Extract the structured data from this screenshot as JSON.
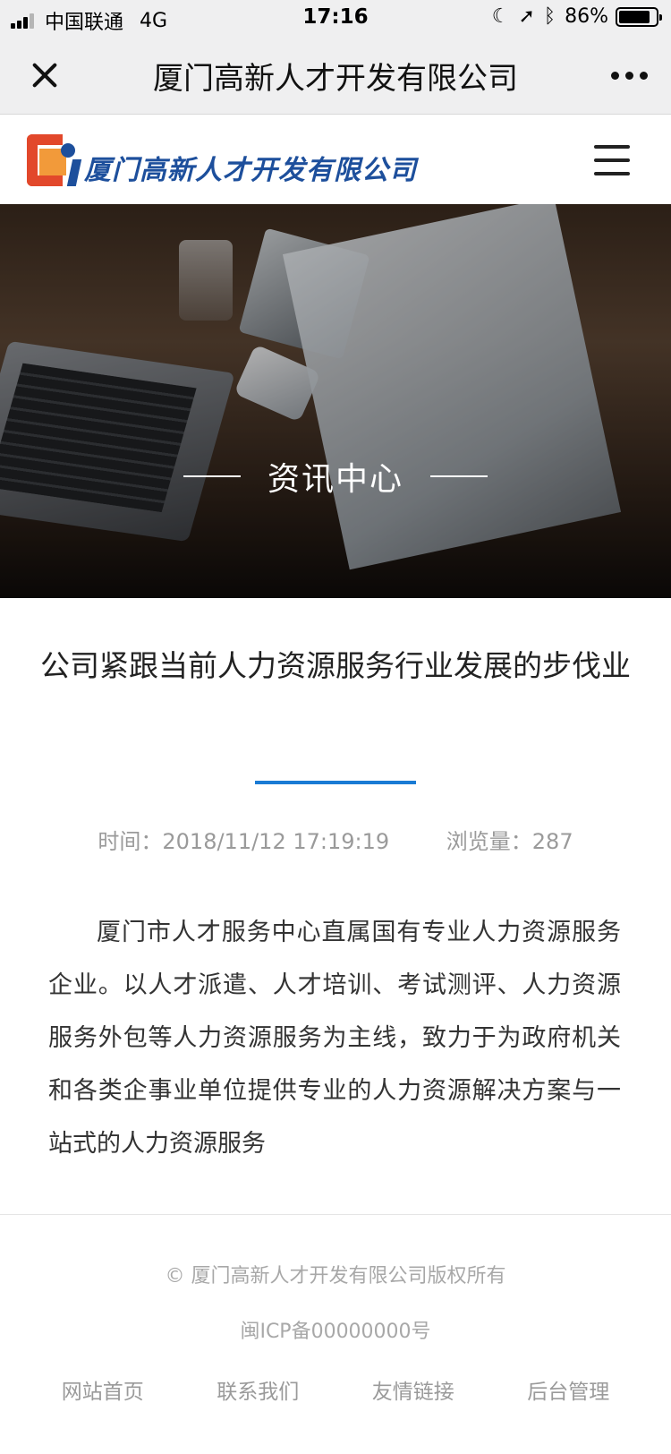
{
  "status_bar": {
    "carrier": "中国联通",
    "network": "4G",
    "time": "17:16",
    "battery": "86%",
    "battery_level": 0.86
  },
  "nav_bar": {
    "title": "厦门高新人才开发有限公司"
  },
  "site_header": {
    "logo_text": "厦门高新人才开发有限公司",
    "colors": {
      "logo_blue": "#1d4f9c",
      "logo_red": "#e2482b",
      "logo_orange": "#f29a3a"
    }
  },
  "banner": {
    "title": "资讯中心"
  },
  "article": {
    "title": "公司紧跟当前人力资源服务行业发展的步伐业",
    "time_label": "时间：",
    "time_value": "2018/11/12 17:19:19",
    "views_label": "浏览量：",
    "views_value": "287",
    "body": "厦门市人才服务中心直属国有专业人力资源服务企业。以人才派遣、人才培训、考试测评、人力资源服务外包等人力资源服务为主线，致力于为政府机关和各类企事业单位提供专业的人力资源解决方案与一站式的人力资源服务",
    "accent_color": "#1a7bd4"
  },
  "footer": {
    "copyright": "© 厦门高新人才开发有限公司版权所有",
    "icp": "闽ICP备00000000号",
    "links": [
      "网站首页",
      "联系我们",
      "友情链接",
      "后台管理"
    ]
  }
}
